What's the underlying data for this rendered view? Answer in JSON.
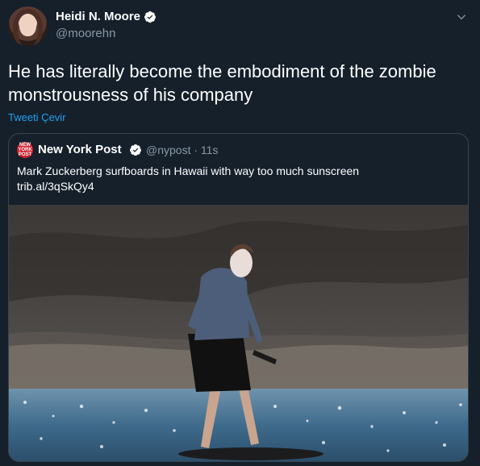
{
  "tweet": {
    "author_name": "Heidi N. Moore",
    "author_handle": "@moorehn",
    "text": "He has literally become the embodiment of the zombie monstrousness of his company",
    "translate_label": "Tweeti Çevir"
  },
  "quote": {
    "author_name": "New York Post",
    "handle_time": "@nypost · 11s",
    "text_line1": "Mark Zuckerberg surfboards in Hawaii with way too much sunscreen",
    "text_line2": "trib.al/3qSkQy4",
    "avatar_text": "NEW YORK POST"
  },
  "icons": {
    "verified": "verified-badge-icon",
    "more": "chevron-down-icon"
  },
  "colors": {
    "background": "#15202b",
    "link": "#1da1f2",
    "secondary_text": "#8899a6",
    "verified": "#ffffff",
    "border": "#38444d",
    "nypost_brand": "#d4202c"
  }
}
